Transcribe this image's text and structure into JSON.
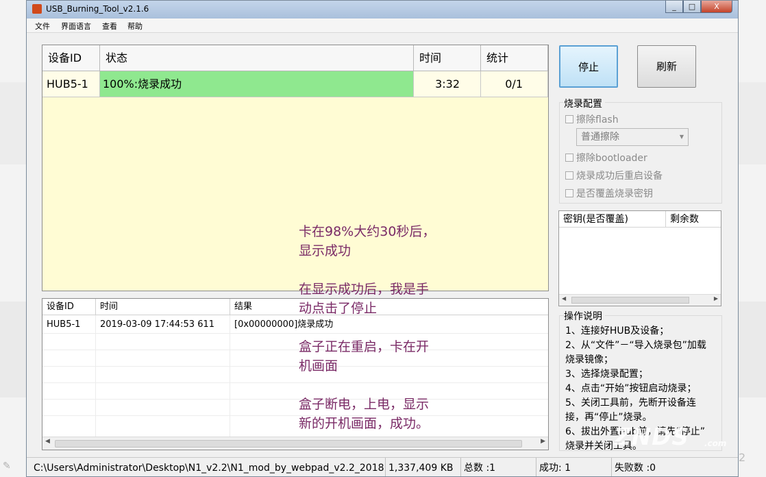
{
  "window": {
    "title": "USB_Burning_Tool_v2.1.6",
    "minimize": "_",
    "maximize": "□",
    "close": "X"
  },
  "menu": [
    "文件",
    "界面语言",
    "查看",
    "帮助"
  ],
  "device_grid": {
    "headers": [
      "设备ID",
      "状态",
      "时间",
      "统计"
    ],
    "rows": [
      {
        "id": "HUB5-1",
        "status": "100%:烧录成功",
        "time": "3:32",
        "count": "0/1"
      }
    ],
    "status_color": "#8fe88f",
    "background": "#fffcd4"
  },
  "log_table": {
    "headers": [
      "设备ID",
      "时间",
      "结果"
    ],
    "rows": [
      {
        "id": "HUB5-1",
        "time": "2019-03-09 17:44:53 611",
        "result": "[0x00000000]烧录成功"
      }
    ]
  },
  "buttons": {
    "stop": "停止",
    "refresh": "刷新"
  },
  "burn_config": {
    "title": "烧录配置",
    "erase_flash": "擦除flash",
    "erase_mode": "普通擦除",
    "erase_bootloader": "擦除bootloader",
    "reboot_after": "烧录成功后重启设备",
    "overwrite_key": "是否覆盖烧录密钥"
  },
  "key_list": {
    "headers": [
      "密钥(是否覆盖)",
      "剩余数"
    ]
  },
  "instructions": {
    "title": "操作说明",
    "lines": [
      "1、连接好HUB及设备；",
      "2、从“文件”－“导入烧录包”加载",
      "烧录镜像；",
      "3、选择烧录配置；",
      "4、点击“开始”按钮启动烧录；",
      "5、关闭工具前，先断开设备连",
      "接，再“停止”烧录。",
      "6、拔出外置hub前，请先“停止”",
      "烧录并关闭工具。"
    ]
  },
  "status_bar": {
    "path": "C:\\Users\\Administrator\\Desktop\\N1_v2.2\\N1_mod_by_webpad_v2.2_2018",
    "size": "1,337,409 KB",
    "total": "总数 :1",
    "success": "成功:  1",
    "fail": "失败数 :0"
  },
  "annotation": [
    "卡在98%大约30秒后，",
    "显示成功",
    "",
    "在显示成功后，我是手",
    "动点击了停止",
    "",
    "盒子正在重启，卡在开",
    "机画面",
    "",
    "盒子断电，上电，显示",
    "新的开机画面，成功。"
  ],
  "watermark": "ZNDS",
  "watermark_sub": ".com",
  "page_number": "2",
  "colors": {
    "annotation": "#7a2a66",
    "stop_button": "#cfe6f7"
  }
}
